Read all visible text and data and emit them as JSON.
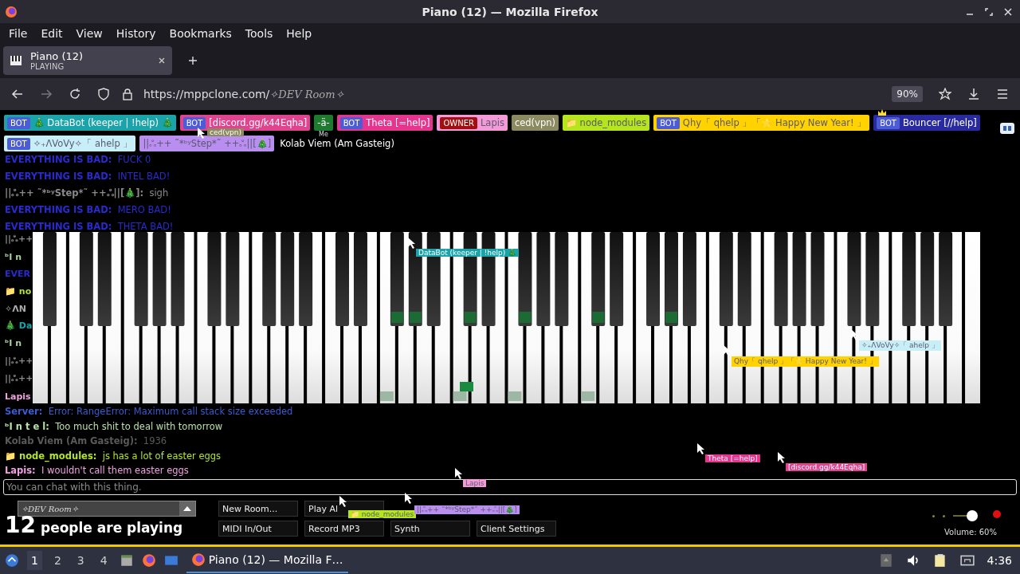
{
  "window": {
    "title": "Piano (12) — Mozilla Firefox"
  },
  "menu": [
    "File",
    "Edit",
    "View",
    "History",
    "Bookmarks",
    "Tools",
    "Help"
  ],
  "tab": {
    "title": "Piano (12)",
    "subtitle": "PLAYING"
  },
  "address": {
    "url": "https://mppclone.com/",
    "room": "✧DEV Room✧",
    "zoom": "90%"
  },
  "users": [
    {
      "badge": {
        "label": "BOT",
        "kind": "bot"
      },
      "name": "🎄 DataBot (keeper | !help) 🎄",
      "color": "#1aa3a8"
    },
    {
      "badge": {
        "label": "BOT",
        "kind": "bot"
      },
      "name": "[discord.gg/k44Eqha]",
      "color": "#e0438f"
    },
    {
      "name": "-ä-",
      "color": "#1e7a2e",
      "tag": "Me"
    },
    {
      "badge": {
        "label": "BOT",
        "kind": "bot"
      },
      "name": "Theta [=help]",
      "color": "#e5358f"
    },
    {
      "badge": {
        "label": "OWNER",
        "kind": "owner"
      },
      "name": "Lapis",
      "color": "#f59ad8"
    },
    {
      "name": "ced(vpn)",
      "color": "#8c8a60"
    },
    {
      "name": "📁 node_modules",
      "color": "#b5e61d"
    },
    {
      "badge": {
        "label": "BOT",
        "kind": "bot"
      },
      "name": "Qhy「 qhelp 」「🌟 Happy New Year! 」",
      "color": "#ffd200"
    },
    {
      "badge": {
        "label": "BOT",
        "kind": "bot"
      },
      "name": "Bouncer [//help]",
      "color": "#2a2aa0",
      "crown": true
    },
    {
      "badge": {
        "label": "BOT",
        "kind": "bot"
      },
      "name": "✧₊ɅVoVy✧「 ahelp 」",
      "color": "#c8eef8"
    },
    {
      "name": "||ஃ++ ˜*ᵇʸStep*˜ ++ஃ||[🎄]",
      "color": "#b98ef0"
    },
    {
      "name": "Kolab Viem (Am Gasteig)"
    }
  ],
  "chat_top": [
    {
      "name": "EVERYTHING IS BAD:",
      "text": "FUCK 0",
      "color": "#2a2ad0"
    },
    {
      "name": "EVERYTHING IS BAD:",
      "text": "INTEL BAD!",
      "color": "#2a2ad0"
    },
    {
      "name": "||ஃ++ ˜*ᵇʸStep*˜ ++ஃ||[🎄]:",
      "text": "sigh",
      "color": "#8a8a8a"
    },
    {
      "name": "EVERYTHING IS BAD:",
      "text": "MERO BAD!",
      "color": "#2a2ad0"
    },
    {
      "name": "EVERYTHING IS BAD:",
      "text": "THETA BAD!",
      "color": "#2a2ad0"
    }
  ],
  "chat_hidden": [
    {
      "text": "||ஃ++",
      "color": "#8a8a8a"
    },
    {
      "text": "ᵇI n",
      "color": "#a8d0a0"
    },
    {
      "text": "EVER",
      "color": "#2a2ad0"
    },
    {
      "text": "📁 no",
      "color": "#b5e61d"
    },
    {
      "text": "✧ɅN",
      "color": "#aaaaaa"
    },
    {
      "text": "🎄 Da",
      "color": "#1aa3a8"
    },
    {
      "text": "ᵇI n",
      "color": "#a8d0a0"
    },
    {
      "text": "||ஃ++",
      "color": "#8a8a8a"
    },
    {
      "text": "||ஃ++",
      "color": "#8a8a8a"
    },
    {
      "text": "Lapis",
      "color": "#f0a0e0"
    }
  ],
  "chat_bottom": [
    {
      "name": "Server:",
      "text": "Error: RangeError: Maximum call stack size exceeded",
      "color": "#3b5bd0"
    },
    {
      "name": "ᵇI n t e l:",
      "text": "Too much shit to deal with tomorrow",
      "color": "#b8e0a8"
    },
    {
      "name": "Kolab Viem (Am Gasteig):",
      "text": "1936",
      "color": "#5a5a5a"
    },
    {
      "name": "📁 node_modules:",
      "text": "js has a lot of easter eggs",
      "color": "#b5e61d"
    },
    {
      "name": "Lapis:",
      "text": "I wouldn't call them easter eggs",
      "color": "#f0a0e0"
    }
  ],
  "chat_input": {
    "placeholder": "You can chat with this thing."
  },
  "cursors": [
    {
      "name": "DataBot (keeper | !help) 🎄",
      "color": "#1aa3a8"
    },
    {
      "name": "Qhy「 qhelp 」「🌟 Happy New Year! 」",
      "color": "#ffd200"
    },
    {
      "name": "✧₊ɅVoVy✧「 ahelp 」",
      "color": "#c8eef8"
    },
    {
      "name": "Theta [=help]",
      "color": "#e5358f"
    },
    {
      "name": "[discord.gg/k44Eqha]",
      "color": "#e0438f"
    },
    {
      "name": "Lapis",
      "color": "#f59ad8"
    },
    {
      "name": "📁 node_modules",
      "color": "#b5e61d"
    },
    {
      "name": "||ஃ++ ˜*ᵇʸStep*˜ ++ஃ||[🎄]",
      "color": "#b98ef0"
    },
    {
      "name": "ced(vpn)",
      "color": "#8c8a60"
    }
  ],
  "room_select": {
    "value": "✧DEV Room✧"
  },
  "player_count": {
    "number": "12",
    "label": "people are playing"
  },
  "buttons": {
    "row_1": [
      "New Room...",
      "Play Al"
    ],
    "row_2": [
      "MIDI In/Out",
      "Record MP3",
      "Synth",
      "Client Settings"
    ]
  },
  "volume": {
    "level": 0.6,
    "label": "Volume: 60%"
  },
  "taskbar": {
    "workspaces": [
      {
        "label": "1",
        "selected": true
      },
      {
        "label": "2",
        "selected": false
      },
      {
        "label": "3",
        "selected": false
      },
      {
        "label": "4",
        "selected": false
      }
    ],
    "task": "Piano (12) — Mozilla F…",
    "time": "4:36"
  }
}
